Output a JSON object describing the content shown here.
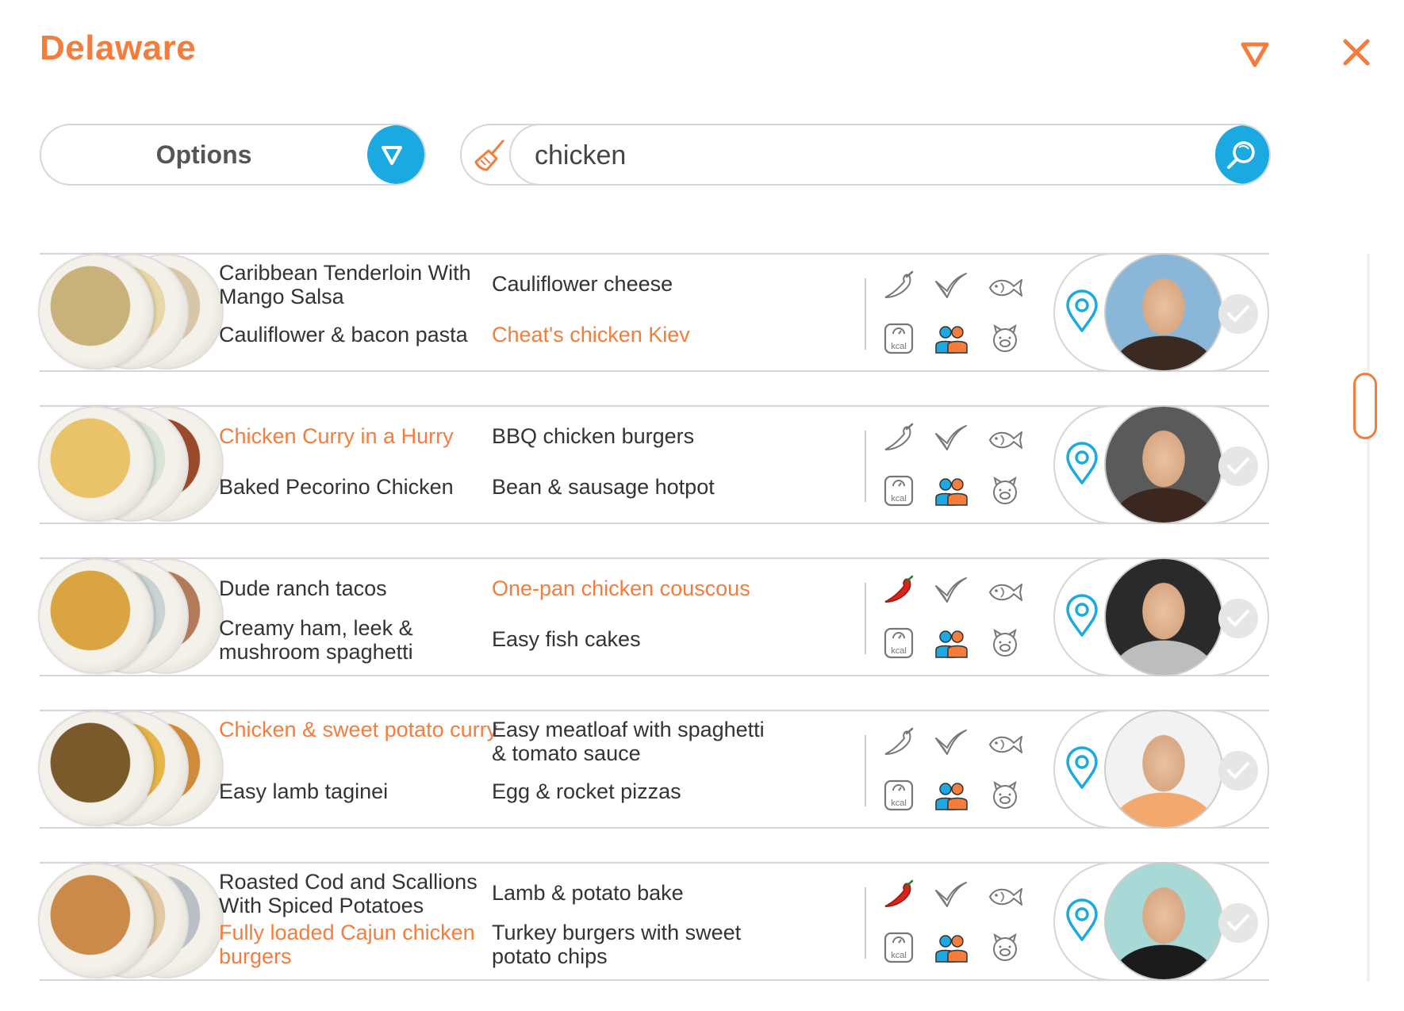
{
  "header": {
    "title": "Delaware"
  },
  "options": {
    "label": "Options"
  },
  "search": {
    "value": "chicken",
    "placeholder": ""
  },
  "colors": {
    "accent": "#f47c3c",
    "blue": "#1aa9e0",
    "chili_red": "#d9261c"
  },
  "rows": [
    {
      "recipes": [
        {
          "name": "Caribbean Tenderloin With Mango Salsa",
          "highlight": false
        },
        {
          "name": "Cauliflower cheese",
          "highlight": false
        },
        {
          "name": "Cauliflower & bacon pasta",
          "highlight": false
        },
        {
          "name": "Cheat's chicken Kiev",
          "highlight": true
        }
      ],
      "spicy": false,
      "icons": [
        "chili-icon",
        "leaf-icon",
        "fish-icon",
        "kcal-icon",
        "people-icon",
        "pig-icon"
      ],
      "kcal_label": "kcal"
    },
    {
      "recipes": [
        {
          "name": "Chicken Curry in a Hurry",
          "highlight": true
        },
        {
          "name": "BBQ chicken burgers",
          "highlight": false
        },
        {
          "name": "Baked Pecorino Chicken",
          "highlight": false
        },
        {
          "name": "Bean & sausage hotpot",
          "highlight": false
        }
      ],
      "spicy": false,
      "icons": [
        "chili-icon",
        "leaf-icon",
        "fish-icon",
        "kcal-icon",
        "people-icon",
        "pig-icon"
      ],
      "kcal_label": "kcal"
    },
    {
      "recipes": [
        {
          "name": "Dude ranch tacos",
          "highlight": false
        },
        {
          "name": "One-pan chicken couscous",
          "highlight": true
        },
        {
          "name": "Creamy ham, leek & mushroom spaghetti",
          "highlight": false
        },
        {
          "name": "Easy fish cakes",
          "highlight": false
        }
      ],
      "spicy": true,
      "icons": [
        "chili-icon",
        "leaf-icon",
        "fish-icon",
        "kcal-icon",
        "people-icon",
        "pig-icon"
      ],
      "kcal_label": "kcal"
    },
    {
      "recipes": [
        {
          "name": "Chicken & sweet potato curry",
          "highlight": true
        },
        {
          "name": "Easy meatloaf with spaghetti & tomato sauce",
          "highlight": false
        },
        {
          "name": "Easy lamb taginei",
          "highlight": false
        },
        {
          "name": "Egg & rocket pizzas",
          "highlight": false
        }
      ],
      "spicy": false,
      "icons": [
        "chili-icon",
        "leaf-icon",
        "fish-icon",
        "kcal-icon",
        "people-icon",
        "pig-icon"
      ],
      "kcal_label": "kcal"
    },
    {
      "recipes": [
        {
          "name": "Roasted Cod and Scallions With Spiced Potatoes",
          "highlight": false
        },
        {
          "name": "Lamb & potato bake",
          "highlight": false
        },
        {
          "name": "Fully loaded Cajun chicken burgers",
          "highlight": true
        },
        {
          "name": "Turkey burgers with sweet potato chips",
          "highlight": false
        }
      ],
      "spicy": true,
      "icons": [
        "chili-icon",
        "leaf-icon",
        "fish-icon",
        "kcal-icon",
        "people-icon",
        "pig-icon"
      ],
      "kcal_label": "kcal"
    }
  ]
}
